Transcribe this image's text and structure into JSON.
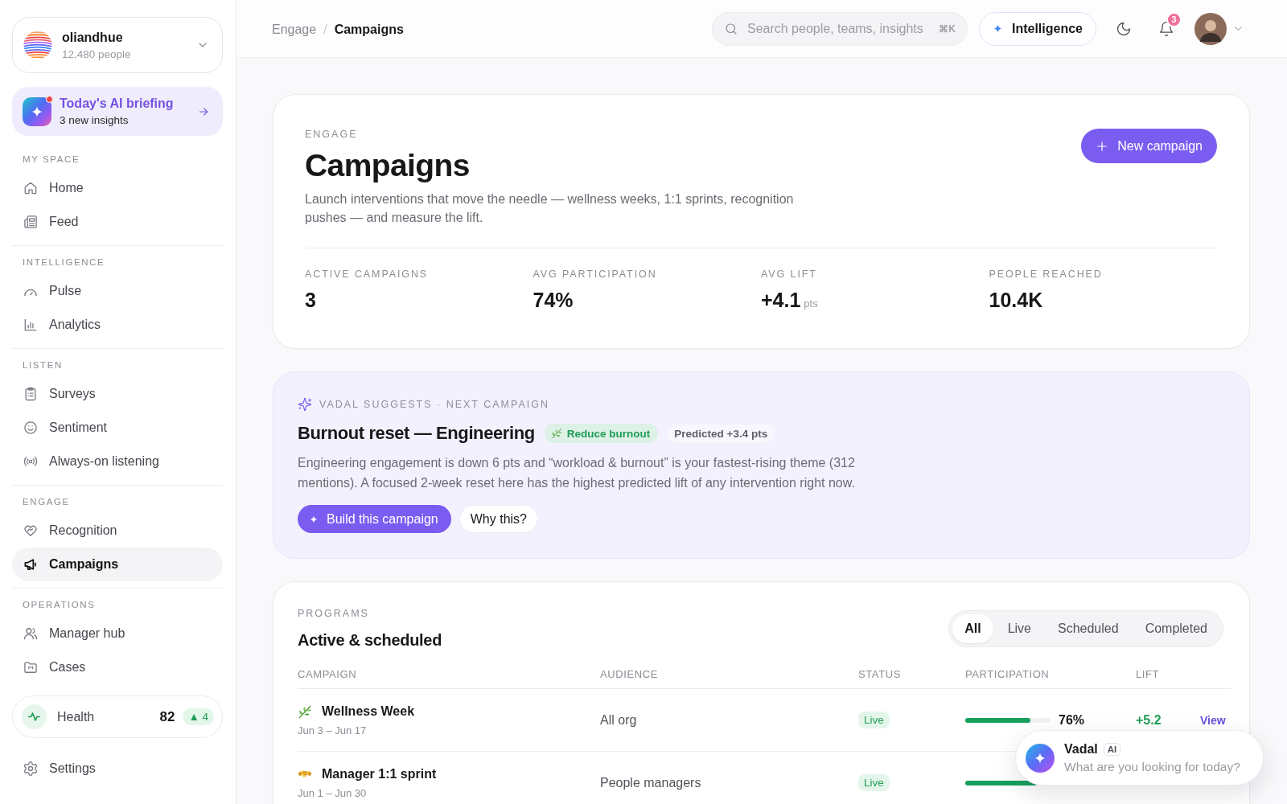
{
  "sidebar": {
    "workspace": {
      "name": "oliandhue",
      "members": "12,480 people"
    },
    "briefing": {
      "title": "Today's AI briefing",
      "subtitle": "3 new insights",
      "unread": true
    },
    "sections": [
      {
        "label": "MY SPACE",
        "items": [
          {
            "label": "Home",
            "selected": false
          },
          {
            "label": "Feed",
            "selected": false
          }
        ]
      },
      {
        "label": "INTELLIGENCE",
        "items": [
          {
            "label": "Pulse",
            "selected": false
          },
          {
            "label": "Analytics",
            "selected": false
          }
        ]
      },
      {
        "label": "LISTEN",
        "items": [
          {
            "label": "Surveys",
            "selected": false
          },
          {
            "label": "Sentiment",
            "selected": false
          },
          {
            "label": "Always-on listening",
            "selected": false
          }
        ]
      },
      {
        "label": "ENGAGE",
        "items": [
          {
            "label": "Recognition",
            "selected": false
          },
          {
            "label": "Campaigns",
            "selected": true
          }
        ]
      },
      {
        "label": "OPERATIONS",
        "items": [
          {
            "label": "Manager hub",
            "selected": false
          },
          {
            "label": "Cases",
            "selected": false
          }
        ]
      }
    ],
    "health": {
      "label": "Health",
      "score": "82",
      "change": "▲ 4"
    },
    "settings": {
      "label": "Settings",
      "selected": false
    }
  },
  "topbar": {
    "breadcrumb": [
      {
        "label": "Engage",
        "current": false
      },
      {
        "label": "Campaigns",
        "current": true
      }
    ],
    "separator": "/",
    "search": {
      "placeholder": "Search people, teams, insights",
      "shortcut": "⌘K"
    },
    "intelligence": {
      "label": "Intelligence"
    },
    "notifications": {
      "count": "3"
    }
  },
  "header": {
    "eyebrow": "ENGAGE",
    "title": "Campaigns",
    "description": "Launch interventions that move the needle — wellness weeks, 1:1 sprints, recognition pushes — and measure the lift.",
    "action": {
      "label": "New campaign"
    },
    "stats": [
      {
        "label": "ACTIVE CAMPAIGNS",
        "value": "3"
      },
      {
        "label": "AVG PARTICIPATION",
        "value": "74%"
      },
      {
        "label": "AVG LIFT",
        "value": "+4.1",
        "unit": "pts"
      },
      {
        "label": "PEOPLE REACHED",
        "value": "10.4K"
      }
    ]
  },
  "suggestion": {
    "eyebrow": "VADAL SUGGESTS · NEXT CAMPAIGN",
    "title": "Burnout reset — Engineering",
    "tag": "Reduce burnout",
    "prediction": "Predicted +3.4 pts",
    "description": "Engineering engagement is down 6 pts and “workload & burnout” is your fastest-rising theme (312 mentions). A focused 2-week reset here has the highest predicted lift of any intervention right now.",
    "actions": [
      {
        "label": "Build this campaign",
        "kind": "primary"
      },
      {
        "label": "Why this?",
        "kind": "secondary"
      }
    ]
  },
  "programs": {
    "eyebrow": "PROGRAMS",
    "title": "Active & scheduled",
    "filters": [
      {
        "label": "All",
        "selected": true
      },
      {
        "label": "Live",
        "selected": false
      },
      {
        "label": "Scheduled",
        "selected": false
      },
      {
        "label": "Completed",
        "selected": false
      }
    ],
    "table": {
      "columns": [
        "CAMPAIGN",
        "AUDIENCE",
        "STATUS",
        "PARTICIPATION",
        "LIFT"
      ],
      "rows": [
        {
          "name": "Wellness Week",
          "dates": "Jun 3 – Jun 17",
          "audience": "All org",
          "status": "Live",
          "level": 0.76,
          "participation": "76%",
          "lift": "+5.2",
          "action": "View"
        },
        {
          "name": "Manager 1:1 sprint",
          "dates": "Jun 1 – Jun 30",
          "audience": "People managers",
          "status": "Live",
          "level": 0.84
        }
      ]
    }
  },
  "assistant": {
    "name": "Vadal",
    "badge": "AI",
    "prompt": "What are you looking for today?"
  }
}
